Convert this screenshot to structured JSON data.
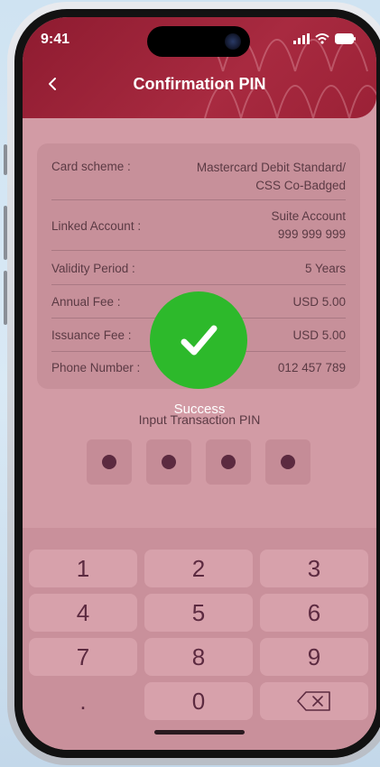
{
  "status_bar": {
    "time": "9:41"
  },
  "header": {
    "title": "Confirmation PIN"
  },
  "details": [
    {
      "label": "Card scheme :",
      "value": "Mastercard Debit Standard/\nCSS Co-Badged"
    },
    {
      "label": "Linked Account :",
      "value": "Suite Account\n999 999 999"
    },
    {
      "label": "Validity Period :",
      "value": "5 Years"
    },
    {
      "label": "Annual Fee :",
      "value": "USD 5.00"
    },
    {
      "label": "Issuance Fee :",
      "value": "USD 5.00"
    },
    {
      "label": "Phone Number :",
      "value": "012 457 789"
    }
  ],
  "pin": {
    "label": "Input Transaction PIN",
    "filled": 4,
    "length": 4
  },
  "keypad": {
    "keys": [
      "1",
      "2",
      "3",
      "4",
      "5",
      "6",
      "7",
      "8",
      "9",
      ".",
      "0"
    ]
  },
  "overlay": {
    "text": "Success"
  },
  "colors": {
    "header": "#9b2136",
    "screen_bg": "#d29ba5",
    "success": "#2db92b"
  },
  "icons": {
    "back": "chevron-left-icon",
    "delete": "backspace-icon",
    "success": "checkmark-icon"
  }
}
